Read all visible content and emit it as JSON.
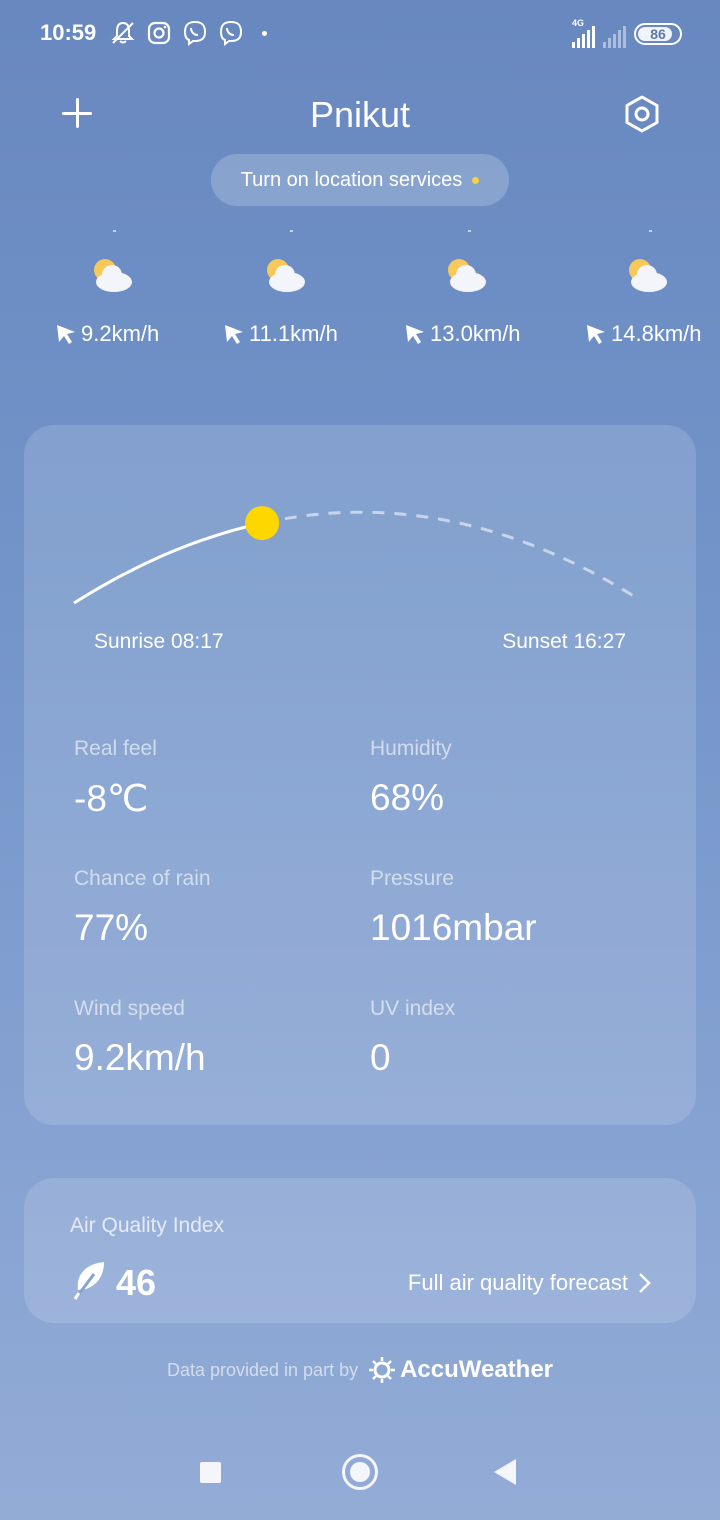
{
  "status_bar": {
    "time": "10:59",
    "network": "4G",
    "battery": "86",
    "battery_level": 0.86,
    "icons": [
      "bell-off-icon",
      "instagram-icon",
      "viber-icon",
      "viber-icon"
    ]
  },
  "header": {
    "title": "Pnikut",
    "add_icon": "plus-icon",
    "settings_icon": "settings-icon"
  },
  "location_prompt": {
    "label": "Turn on location services"
  },
  "hourly": [
    {
      "icon": "partly-cloudy-icon",
      "wind": "9.2km/h"
    },
    {
      "icon": "partly-cloudy-icon",
      "wind": "11.1km/h"
    },
    {
      "icon": "partly-cloudy-icon",
      "wind": "13.0km/h"
    },
    {
      "icon": "partly-cloudy-icon",
      "wind": "14.8km/h"
    }
  ],
  "sun": {
    "sunrise": "Sunrise 08:17",
    "sunset": "Sunset 16:27",
    "day_progress": 0.33
  },
  "details": {
    "real_feel": {
      "label": "Real feel",
      "value": "-8℃"
    },
    "humidity": {
      "label": "Humidity",
      "value": "68%"
    },
    "chance_of_rain": {
      "label": "Chance of rain",
      "value": "77%"
    },
    "pressure": {
      "label": "Pressure",
      "value": "1016mbar"
    },
    "wind_speed": {
      "label": "Wind speed",
      "value": "9.2km/h"
    },
    "uv_index": {
      "label": "UV index",
      "value": "0"
    }
  },
  "aqi": {
    "title": "Air Quality Index",
    "value": "46",
    "link": "Full air quality forecast"
  },
  "provider": {
    "text": "Data provided in part by",
    "name": "AccuWeather"
  },
  "colors": {
    "sun": "#ffd700",
    "location_dot": "#f5d43c",
    "background_top": "#6888bf",
    "background_bottom": "#93acd6"
  }
}
